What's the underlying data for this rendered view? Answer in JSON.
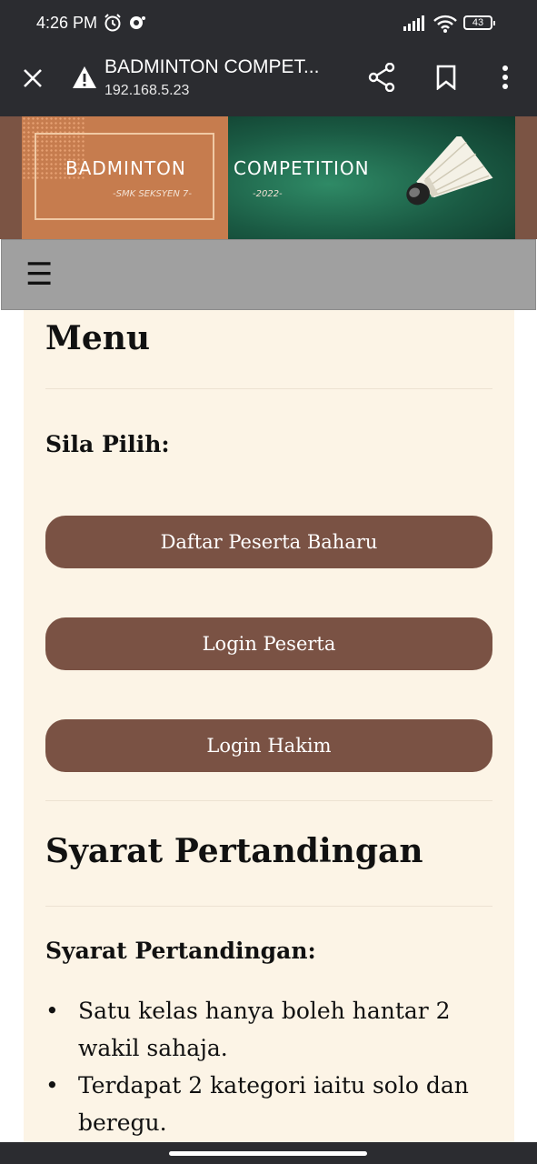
{
  "status_bar": {
    "time": "4:26 PM",
    "battery": "43",
    "icons": [
      "alarm-icon",
      "notification-icon",
      "signal-icon",
      "wifi-icon",
      "battery-icon"
    ]
  },
  "browser": {
    "title": "BADMINTON COMPET...",
    "url": "192.168.5.23",
    "icons": [
      "close-icon",
      "warning-icon",
      "share-icon",
      "bookmark-icon",
      "more-icon"
    ]
  },
  "banner": {
    "title_part1": "BADMINTON",
    "title_part2": "COMPETITION",
    "school": "-SMK SEKSYEN 7-",
    "year": "-2022-"
  },
  "nav": {
    "menu_icon": "hamburger-icon",
    "menu_glyph": "☰"
  },
  "menu": {
    "heading": "Menu",
    "prompt": "Sila Pilih:",
    "buttons": [
      {
        "label": "Daftar Peserta Baharu"
      },
      {
        "label": "Login Peserta"
      },
      {
        "label": "Login Hakim"
      }
    ]
  },
  "rules_section": {
    "heading": "Syarat Pertandingan",
    "subheading": "Syarat Pertandingan:",
    "items": [
      "Satu kelas hanya boleh hantar 2 wakil sahaja.",
      "Terdapat 2 kategori iaitu solo dan beregu."
    ]
  },
  "colors": {
    "button": "#7a5244",
    "card_bg": "#fcf4e6",
    "navbar": "#a0a0a0",
    "banner_accent": "#c67c4e"
  }
}
